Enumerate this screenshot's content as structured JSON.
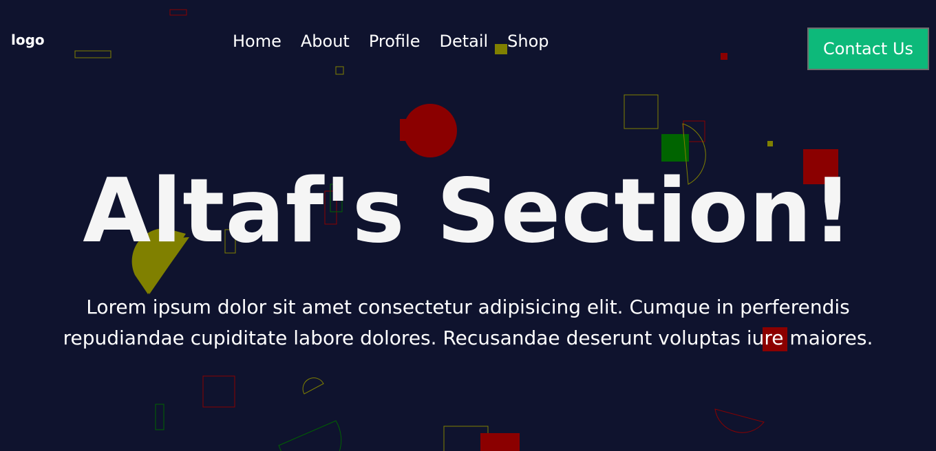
{
  "header": {
    "logo": "logo",
    "nav": [
      "Home",
      "About",
      "Profile",
      "Detail",
      "Shop"
    ],
    "contact_label": "Contact Us"
  },
  "hero": {
    "title": "Altaf's Section!",
    "text": "Lorem ipsum dolor sit amet consectetur adipisicing elit. Cumque in perferendis repudiandae cupiditate labore dolores. Recusandae deserunt voluptas iure maiores."
  },
  "colors": {
    "background": "#0f132e",
    "accent": "#0db97a",
    "shape_red": "#8b0000",
    "shape_green": "#006400",
    "shape_olive": "#808000"
  }
}
